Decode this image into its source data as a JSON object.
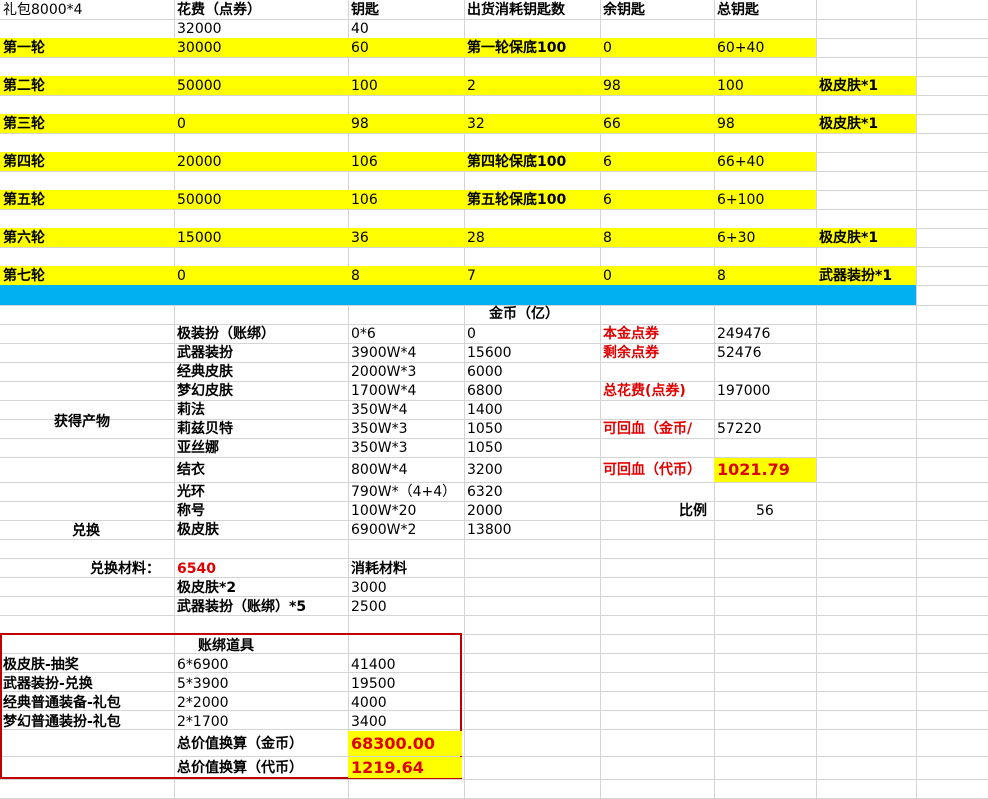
{
  "header": {
    "gift": "礼包8000*4",
    "cost": "花费（点券）",
    "keys": "钥匙",
    "consumed": "出货消耗钥匙数",
    "remain": "余钥匙",
    "total": "总钥匙"
  },
  "gift_row": {
    "cost": "32000",
    "keys": "40"
  },
  "rounds": [
    {
      "name": "第一轮",
      "cost": "30000",
      "keys": "60",
      "consumed": "第一轮保底100",
      "remain": "0",
      "total": "60+40",
      "reward": ""
    },
    {
      "name": "第二轮",
      "cost": "50000",
      "keys": "100",
      "consumed": "2",
      "remain": "98",
      "total": "100",
      "reward": "极皮肤*1"
    },
    {
      "name": "第三轮",
      "cost": "0",
      "keys": "98",
      "consumed": "32",
      "remain": "66",
      "total": "98",
      "reward": "极皮肤*1"
    },
    {
      "name": "第四轮",
      "cost": "20000",
      "keys": "106",
      "consumed": "第四轮保底100",
      "remain": "6",
      "total": "66+40",
      "reward": ""
    },
    {
      "name": "第五轮",
      "cost": "50000",
      "keys": "106",
      "consumed": "第五轮保底100",
      "remain": "6",
      "total": "6+100",
      "reward": ""
    },
    {
      "name": "第六轮",
      "cost": "15000",
      "keys": "36",
      "consumed": "28",
      "remain": "8",
      "total": "6+30",
      "reward": "极皮肤*1"
    },
    {
      "name": "第七轮",
      "cost": "0",
      "keys": "8",
      "consumed": "7",
      "remain": "0",
      "total": "8",
      "reward": "武器装扮*1"
    }
  ],
  "gold_header": "金币（亿）",
  "obtained_label": "获得产物",
  "exchange_label": "兑换",
  "products": [
    {
      "name": "极装扮（账绑）",
      "formula": "0*6",
      "gold": "0"
    },
    {
      "name": "武器装扮",
      "formula": "3900W*4",
      "gold": "15600"
    },
    {
      "name": "经典皮肤",
      "formula": "2000W*3",
      "gold": "6000"
    },
    {
      "name": "梦幻皮肤",
      "formula": "1700W*4",
      "gold": "6800"
    },
    {
      "name": "莉法",
      "formula": "350W*4",
      "gold": "1400"
    },
    {
      "name": "莉兹贝特",
      "formula": "350W*3",
      "gold": "1050"
    },
    {
      "name": "亚丝娜",
      "formula": "350W*3",
      "gold": "1050"
    },
    {
      "name": "结衣",
      "formula": "800W*4",
      "gold": "3200"
    },
    {
      "name": "光环",
      "formula": "790W*（4+4）",
      "gold": "6320"
    },
    {
      "name": "称号",
      "formula": "100W*20",
      "gold": "2000"
    },
    {
      "name": "极皮肤",
      "formula": "6900W*2",
      "gold": "13800"
    }
  ],
  "summary": {
    "principal_label": "本金点券",
    "principal_value": "249476",
    "remaining_label": "剩余点券",
    "remaining_value": "52476",
    "spent_label": "总花费(点券)",
    "spent_value": "197000",
    "gold_back_label": "可回血（金币/",
    "gold_back_value": "57220",
    "token_back_label": "可回血（代币）",
    "token_back_value": "1021.79",
    "ratio_label": "比例",
    "ratio_value": "56"
  },
  "exchange_material": {
    "label": "兑换材料：",
    "value": "6540",
    "consume_label": "消耗材料",
    "items": [
      {
        "name": "极皮肤*2",
        "value": "3000"
      },
      {
        "name": "武器装扮（账绑）*5",
        "value": "2500"
      }
    ]
  },
  "bound_items": {
    "title": "账绑道具",
    "rows": [
      {
        "name": "极皮肤-抽奖",
        "formula": "6*6900",
        "value": "41400"
      },
      {
        "name": "武器装扮-兑换",
        "formula": "5*3900",
        "value": "19500"
      },
      {
        "name": "经典普通装备-礼包",
        "formula": "2*2000",
        "value": "4000"
      },
      {
        "name": "梦幻普通装扮-礼包",
        "formula": "2*1700",
        "value": "3400"
      }
    ],
    "total_gold_label": "总价值换算（金币）",
    "total_gold_value": "68300.00",
    "total_token_label": "总价值换算（代币）",
    "total_token_value": "1219.64"
  },
  "colors": {
    "highlight": "#ffff00",
    "band": "#00b0f0",
    "emphasis": "#e00000",
    "grid": "#d4d4d4"
  }
}
